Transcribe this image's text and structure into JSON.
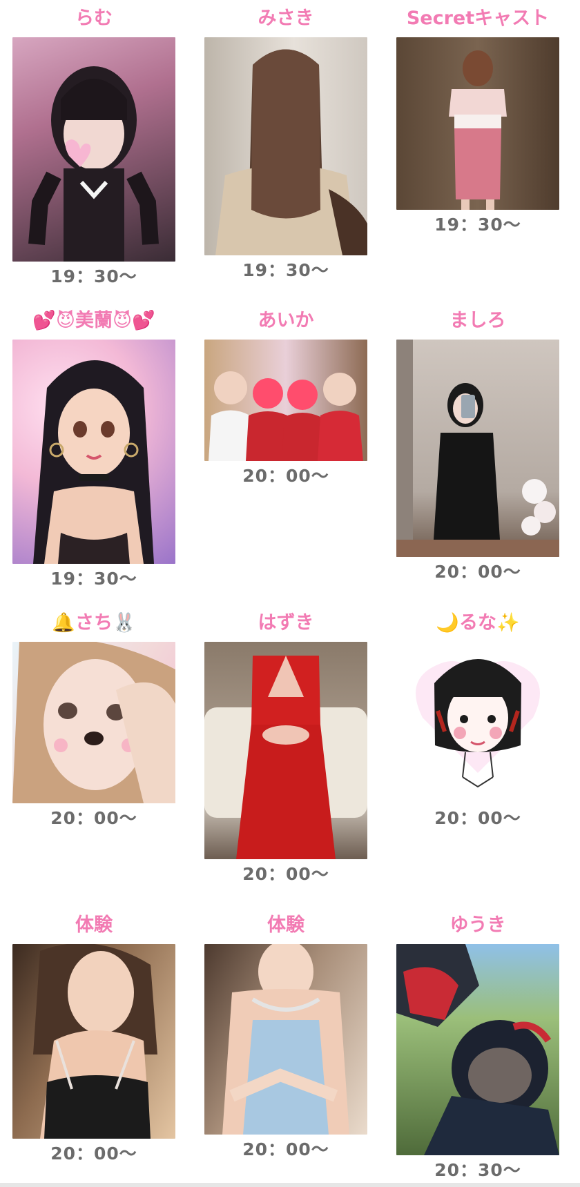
{
  "casts": [
    {
      "name": "らむ",
      "time": "19：30〜",
      "colors": [
        "#d7a6c0",
        "#3a2c35"
      ]
    },
    {
      "name": "みさき",
      "time": "19：30〜",
      "colors": [
        "#d9d3cc",
        "#5a4032"
      ]
    },
    {
      "name": "Secretキャスト",
      "time": "19：30〜",
      "colors": [
        "#6e5a45",
        "#d7798a"
      ]
    },
    {
      "name": "💕😈美蘭😈💕",
      "time": "19：30〜",
      "colors": [
        "#f3b9d6",
        "#3b2d3a"
      ]
    },
    {
      "name": "あいか",
      "time": "20：00〜",
      "colors": [
        "#e9cfd8",
        "#c9272f"
      ]
    },
    {
      "name": "ましろ",
      "time": "20：00〜",
      "colors": [
        "#cfc6bf",
        "#151515"
      ]
    },
    {
      "name": "🔔さち🐰",
      "time": "20：00〜",
      "colors": [
        "#f2d9d9",
        "#b98f78"
      ]
    },
    {
      "name": "はずき",
      "time": "20：00〜",
      "colors": [
        "#ede7dc",
        "#d12020"
      ]
    },
    {
      "name": "🌙るな✨",
      "time": "20：00〜",
      "colors": [
        "#fde8f5",
        "#222222"
      ]
    },
    {
      "name": "体験",
      "time": "20：00〜",
      "colors": [
        "#e4c5a2",
        "#1b1b1b"
      ]
    },
    {
      "name": "体験",
      "time": "20：00〜",
      "colors": [
        "#eadbcc",
        "#a8c8e1"
      ]
    },
    {
      "name": "ゆうき",
      "time": "20：30〜",
      "colors": [
        "#9bbf7a",
        "#1f2a3d"
      ]
    }
  ]
}
